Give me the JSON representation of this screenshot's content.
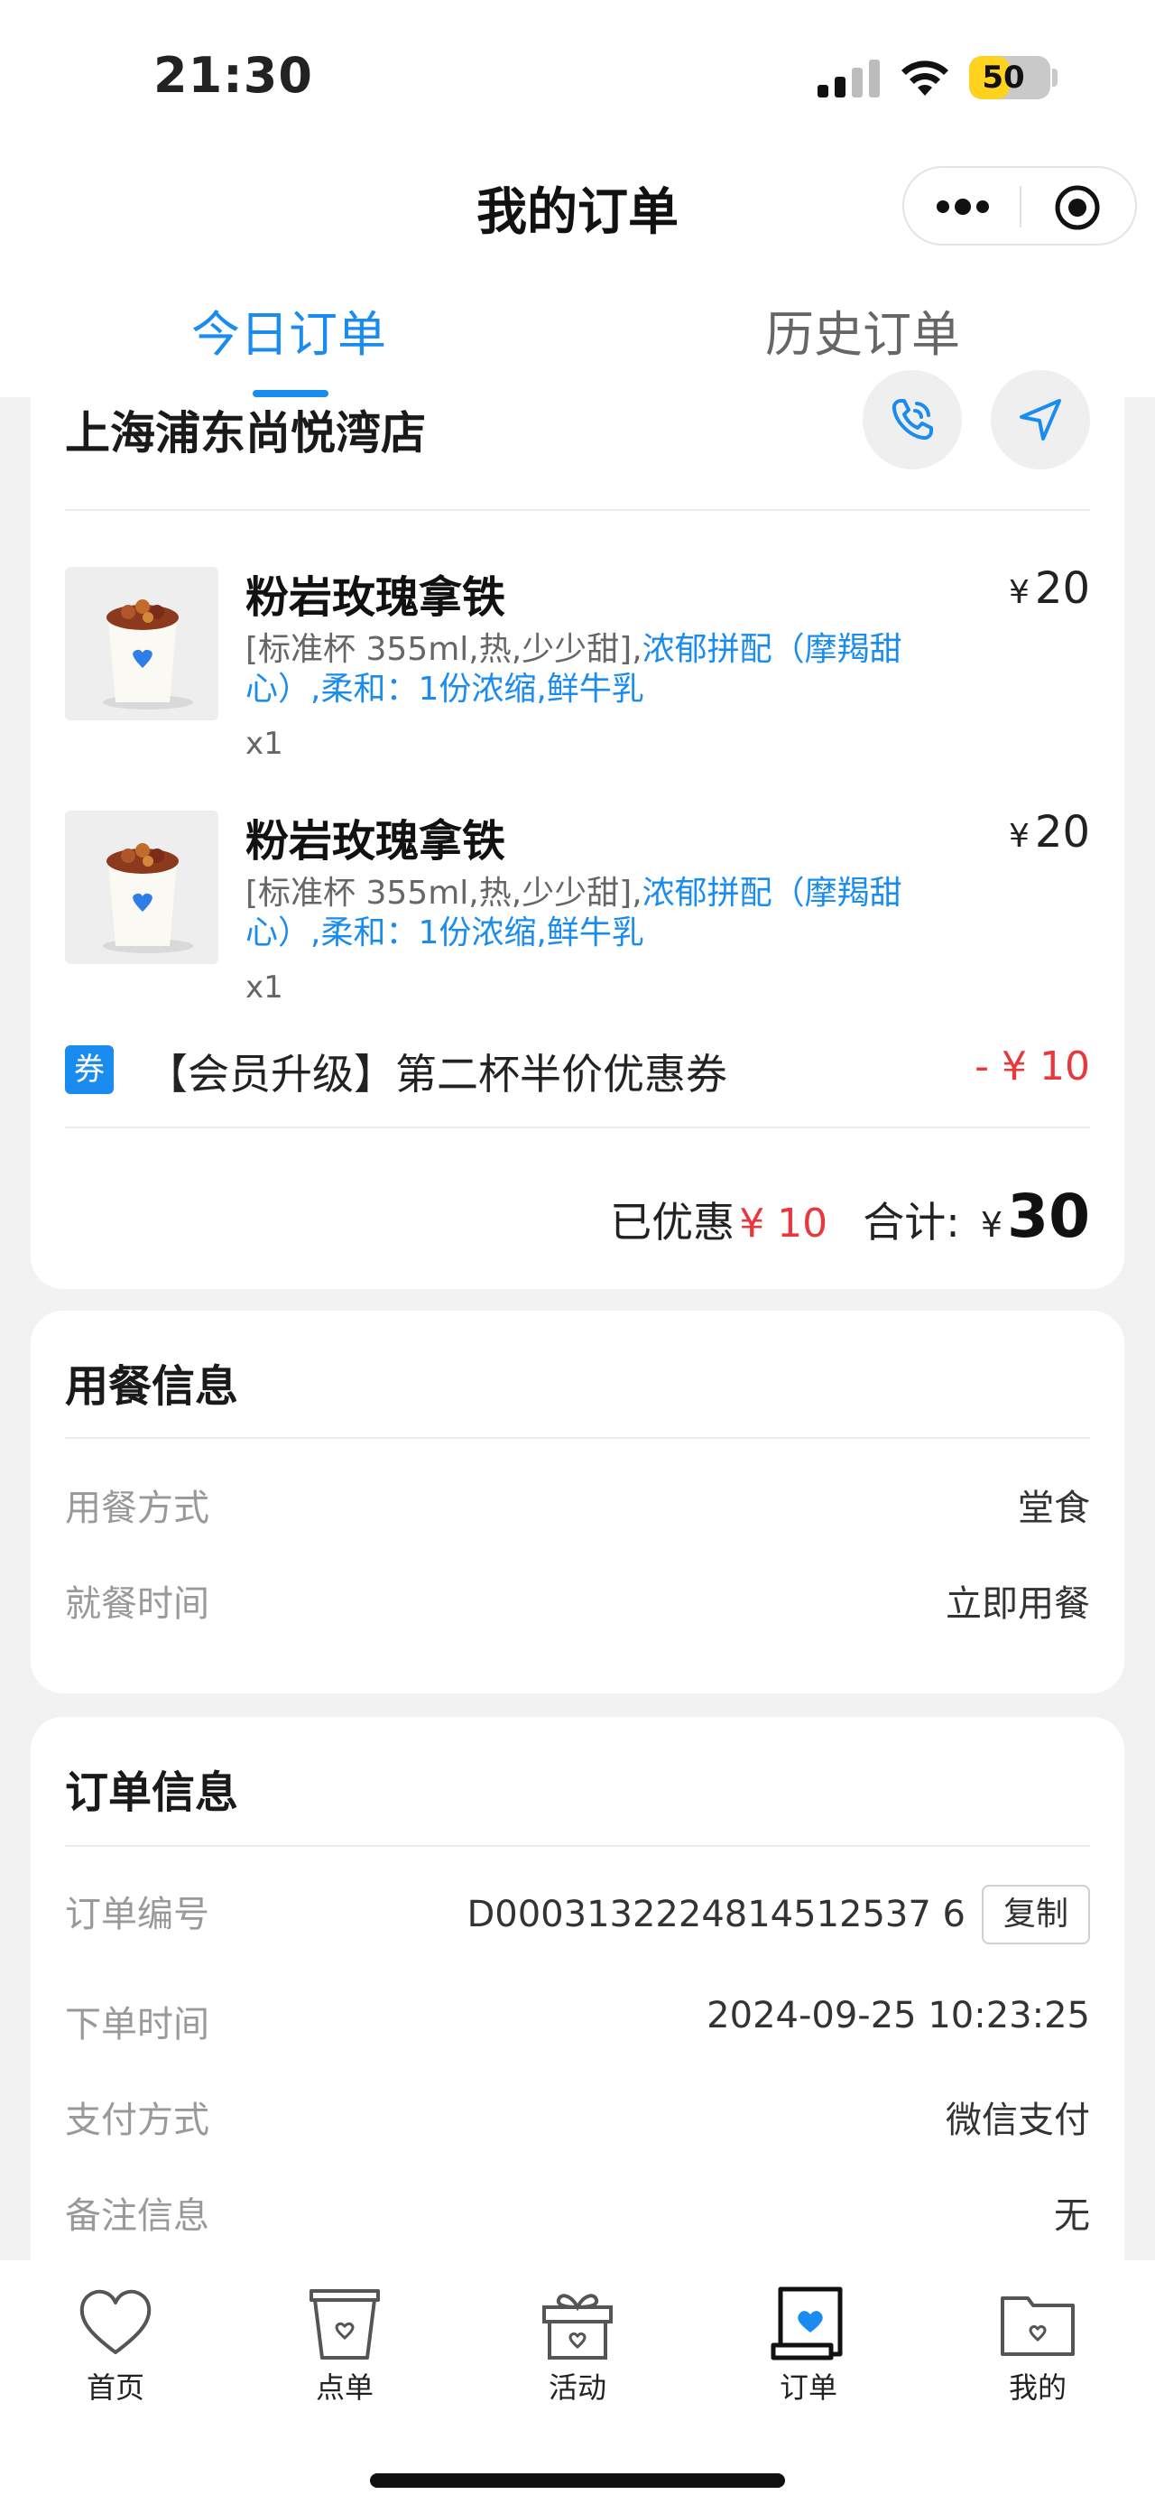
{
  "status_bar": {
    "time": "21:30",
    "battery": "50",
    "battery_level": 0.5
  },
  "nav": {
    "title": "我的订单"
  },
  "tabs": {
    "today": "今日订单",
    "history": "历史订单",
    "active": "today"
  },
  "order": {
    "store_name": "上海浦东尚悦湾店",
    "items": [
      {
        "name": "粉岩玫瑰拿铁",
        "currency": "¥",
        "price": "20",
        "spec_plain": "[标准杯 355ml,热,少少甜],",
        "spec_blue": "浓郁拼配（摩羯甜心）,柔和：1份浓缩,鲜牛乳",
        "qty": "x1"
      },
      {
        "name": "粉岩玫瑰拿铁",
        "currency": "¥",
        "price": "20",
        "spec_plain": "[标准杯 355ml,热,少少甜],",
        "spec_blue": "浓郁拼配（摩羯甜心）,柔和：1份浓缩,鲜牛乳",
        "qty": "x1"
      }
    ],
    "coupon": {
      "badge": "券",
      "text": "【会员升级】第二杯半价优惠券",
      "amount": "- ¥ 10"
    },
    "summary": {
      "discount_label": "已优惠",
      "discount_amount": "¥ 10",
      "total_label": "合计:",
      "currency": "¥",
      "total": "30"
    }
  },
  "dining_info": {
    "title": "用餐信息",
    "rows": [
      {
        "label": "用餐方式",
        "value": "堂食"
      },
      {
        "label": "就餐时间",
        "value": "立即用餐"
      }
    ]
  },
  "order_info": {
    "title": "订单信息",
    "order_no_label": "订单编号",
    "order_no": "D0003132224814512537 6",
    "copy_label": "复制",
    "rows": [
      {
        "label": "下单时间",
        "value": "2024-09-25 10:23:25"
      },
      {
        "label": "支付方式",
        "value": "微信支付"
      },
      {
        "label": "备注信息",
        "value": "无"
      }
    ]
  },
  "tabbar": {
    "items": [
      {
        "label": "首页",
        "icon": "heart-icon"
      },
      {
        "label": "点单",
        "icon": "cup-icon"
      },
      {
        "label": "活动",
        "icon": "gift-icon"
      },
      {
        "label": "订单",
        "icon": "order-icon"
      },
      {
        "label": "我的",
        "icon": "folder-icon"
      }
    ],
    "active": "订单"
  },
  "colors": {
    "accent": "#1a8cf0",
    "discount": "#e8383d",
    "battery": "#ffd21f"
  }
}
